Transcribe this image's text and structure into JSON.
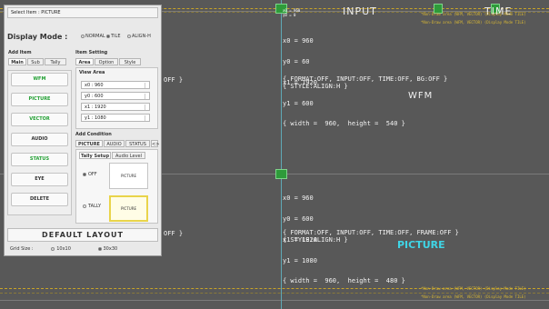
{
  "canvas": {
    "top_label": "INPUT",
    "top_right_label": "TIME",
    "top_dims": [
      "x0 = 960",
      "y0 = 0"
    ],
    "yellow_note": "*Non-Draw area (WFM, VECTOR) (Display Mode TILE)",
    "wfm_block": {
      "lines": [
        "x0 = 960",
        "y0 = 60",
        "x1 = 1920",
        "y1 = 600",
        "{ width =  960,  height =  540 }"
      ],
      "format_line": "{ FORMAT:OFF, INPUT:OFF, TIME:OFF, BG:OFF }",
      "style_line": "{ STYLE:ALIGN:H }",
      "title": "WFM",
      "off_text": "OFF }"
    },
    "picture_block": {
      "lines": [
        "x0 = 960",
        "y0 = 600",
        "x1 = 1920",
        "y1 = 1080",
        "{ width =  960,  height =  480 }"
      ],
      "format_line": "{ FORMAT:OFF, INPUT:OFF, TIME:OFF, FRAME:OFF }",
      "style_line": "{ STYLE:ALIGN:H }",
      "title": "PICTURE",
      "off_text": "OFF }"
    },
    "colors": {
      "accent_cyan": "#3fd5e6",
      "grid_green": "#2e9b3a",
      "note_yellow": "#d9b834"
    }
  },
  "panel": {
    "select_item": "Select Item : PICTURE",
    "display_mode_label": "Display Mode :",
    "display_mode_options": [
      "NORMAL",
      "TILE",
      "ALIGN-H"
    ],
    "add_item_title": "Add Item",
    "add_item_tabs": [
      "Main",
      "Sub",
      "Tally"
    ],
    "items": [
      {
        "label": "WFM",
        "color": "#22a033"
      },
      {
        "label": "PICTURE",
        "color": "#22a033"
      },
      {
        "label": "VECTOR",
        "color": "#22a033"
      },
      {
        "label": "AUDIO",
        "color": "#333333"
      },
      {
        "label": "STATUS",
        "color": "#22a033"
      },
      {
        "label": "EYE",
        "color": "#333333"
      }
    ],
    "delete_label": "DELETE",
    "item_setting_title": "Item Setting",
    "item_setting_tabs": [
      "Area",
      "Option",
      "Style"
    ],
    "view_area_title": "View Area",
    "coords": [
      "x0 : 960",
      "y0 : 600",
      "x1 : 1920",
      "y1 : 1080"
    ],
    "add_condition_title": "Add Condition",
    "condition_tabs": [
      "PICTURE",
      "AUDIO",
      "STATUS"
    ],
    "condition_tab_more": "<>",
    "setup_tabs": [
      "Tally Setup",
      "Audio Level"
    ],
    "off_option": "OFF",
    "tally_option": "TALLY",
    "preview_label": "PICTURE",
    "preview_label_2": "PICTURE",
    "default_layout_label": "DEFAULT LAYOUT",
    "grid_size_label": "Grid Size :",
    "grid_options": [
      "10x10",
      "30x30"
    ]
  }
}
